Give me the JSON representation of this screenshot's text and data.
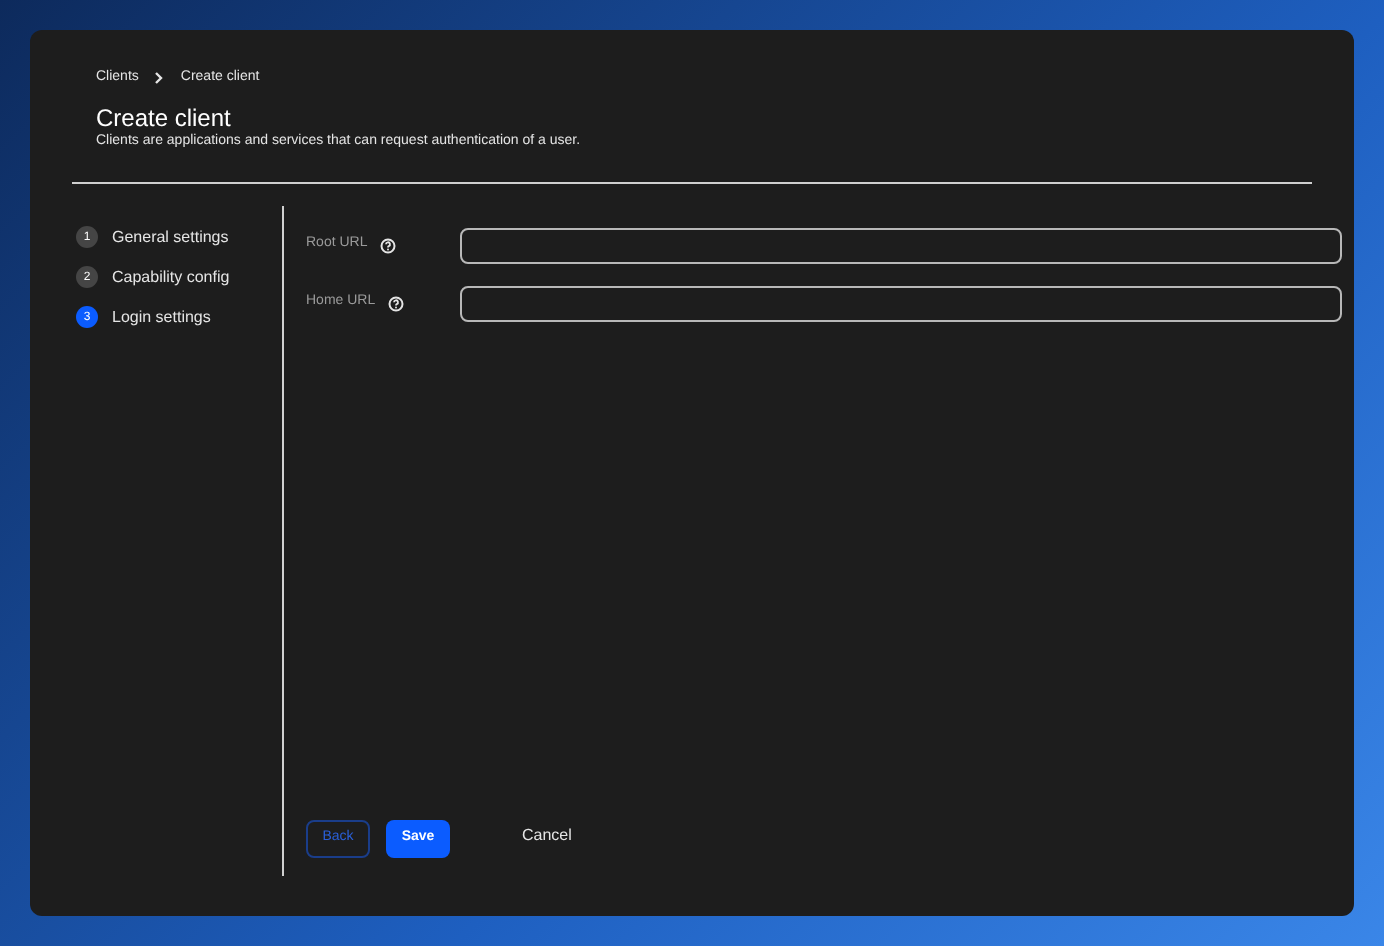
{
  "breadcrumb": [
    {
      "label": "Clients"
    },
    {
      "label": "Create client"
    }
  ],
  "title": "Create client",
  "subtitle": "Clients are applications and services that can request authentication of a user.",
  "steps": [
    {
      "number": "1",
      "label": "General settings",
      "selected": false
    },
    {
      "number": "2",
      "label": "Capability config",
      "selected": false
    },
    {
      "number": "3",
      "label": "Login settings",
      "selected": true
    }
  ],
  "fields": [
    {
      "label": "Root URL"
    },
    {
      "label": "Home URL"
    }
  ],
  "buttons": {
    "back": "Back",
    "save": "Save",
    "cancel": "Cancel"
  }
}
